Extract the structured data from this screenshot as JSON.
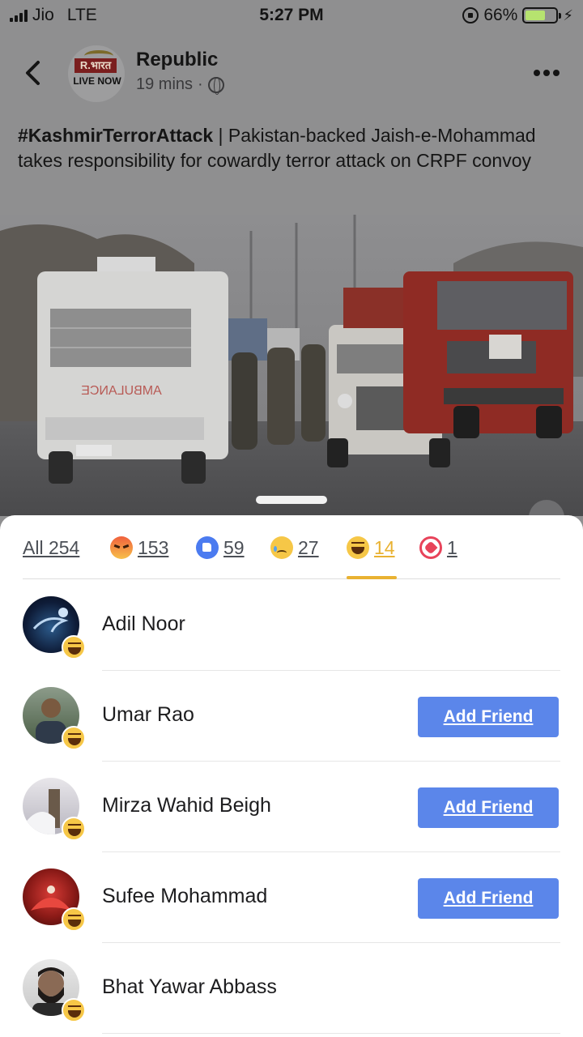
{
  "status": {
    "carrier": "Jio",
    "network": "LTE",
    "time": "5:27 PM",
    "battery_percent": "66%",
    "battery_level": 0.66
  },
  "post": {
    "page_name": "Republic",
    "avatar_logo_top": "R.भारत",
    "avatar_logo_bottom": "LIVE NOW",
    "time_ago": "19 mins",
    "visibility_icon": "globe-icon",
    "hashtag": "#KashmirTerrorAttack",
    "text": " | Pakistan-backed Jaish-e-Mohammad takes responsibility for cowardly terror attack on CRPF convoy",
    "photo_sign_text": "AMBULANCE"
  },
  "reactions": {
    "tabs": [
      {
        "id": "all",
        "label": "All 254",
        "icon": null
      },
      {
        "id": "angry",
        "label": "153",
        "icon": "angry-icon"
      },
      {
        "id": "like",
        "label": "59",
        "icon": "like-icon"
      },
      {
        "id": "sad",
        "label": "27",
        "icon": "sad-icon"
      },
      {
        "id": "haha",
        "label": "14",
        "icon": "haha-icon",
        "selected": true
      },
      {
        "id": "love",
        "label": "1",
        "icon": "love-icon"
      }
    ],
    "people": [
      {
        "name": "Adil Noor",
        "has_add_friend": false,
        "reaction": "haha-icon"
      },
      {
        "name": "Umar Rao",
        "has_add_friend": true,
        "reaction": "haha-icon"
      },
      {
        "name": "Mirza Wahid Beigh",
        "has_add_friend": true,
        "reaction": "haha-icon"
      },
      {
        "name": "Sufee Mohammad",
        "has_add_friend": true,
        "reaction": "haha-icon"
      },
      {
        "name": "Bhat Yawar Abbass",
        "has_add_friend": false,
        "reaction": "haha-icon"
      }
    ],
    "add_friend_label": "Add Friend"
  },
  "colors": {
    "accent_blue": "#5b86ea",
    "haha_yellow": "#e9b232",
    "dim_overlay": "#8f8f90"
  }
}
